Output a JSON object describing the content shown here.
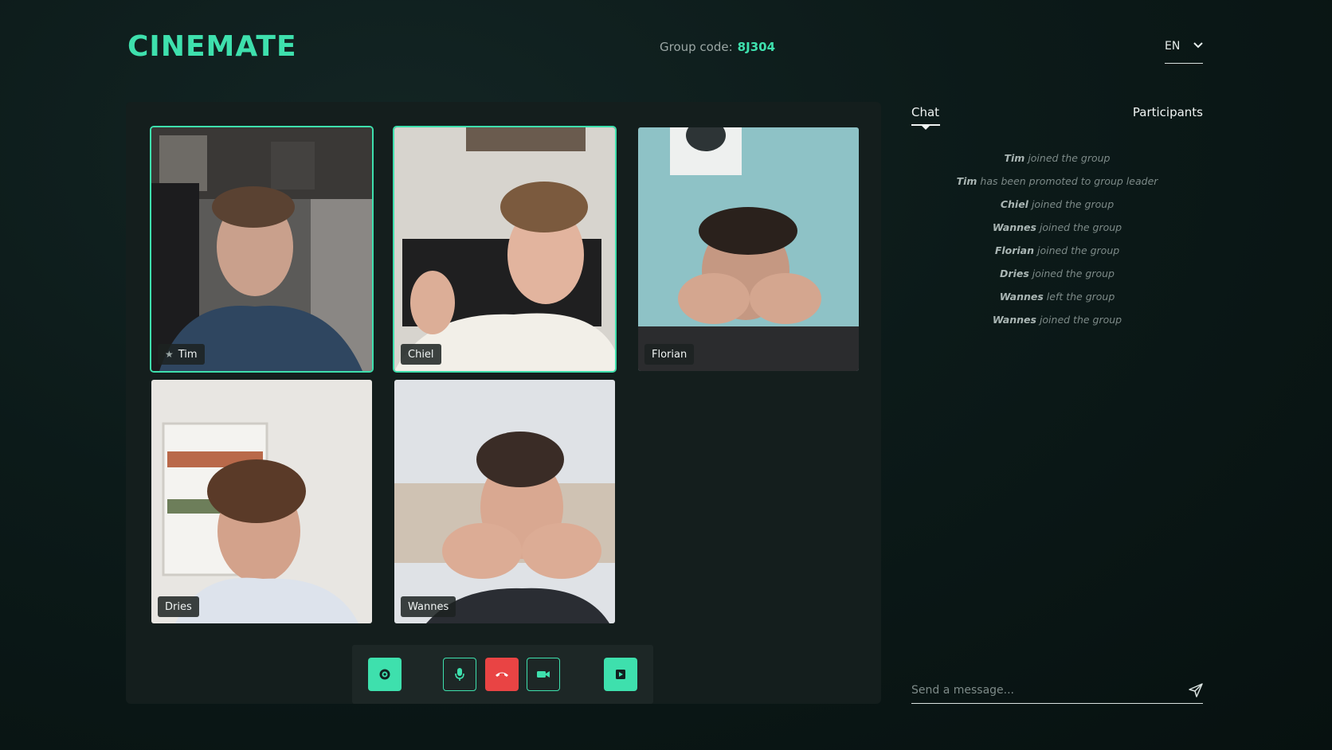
{
  "brand": {
    "name": "CINEMATE",
    "accent": "#3ee0ad"
  },
  "header": {
    "group_label": "Group code:",
    "group_code": "8J304",
    "language": "EN"
  },
  "participants": [
    {
      "name": "Tim",
      "leader": true,
      "active": true
    },
    {
      "name": "Chiel",
      "leader": false,
      "active": true
    },
    {
      "name": "Florian",
      "leader": false,
      "active": false
    },
    {
      "name": "Dries",
      "leader": false,
      "active": false
    },
    {
      "name": "Wannes",
      "leader": false,
      "active": false
    }
  ],
  "controls": {
    "settings": "gear-icon",
    "mic": "microphone-icon",
    "hangup": "phone-hangup-icon",
    "camera": "video-camera-icon",
    "screen": "play-screen-icon",
    "hangup_color": "#e94444"
  },
  "sidebar": {
    "tabs": {
      "chat": "Chat",
      "participants": "Participants"
    },
    "events": [
      {
        "who": "Tim",
        "text": "joined the group"
      },
      {
        "who": "Tim",
        "text": "has been promoted to group leader"
      },
      {
        "who": "Chiel",
        "text": "joined the group"
      },
      {
        "who": "Wannes",
        "text": "joined the group"
      },
      {
        "who": "Florian",
        "text": "joined the group"
      },
      {
        "who": "Dries",
        "text": "joined the group"
      },
      {
        "who": "Wannes",
        "text": "left the group"
      },
      {
        "who": "Wannes",
        "text": "joined the group"
      }
    ],
    "message_placeholder": "Send a message..."
  }
}
